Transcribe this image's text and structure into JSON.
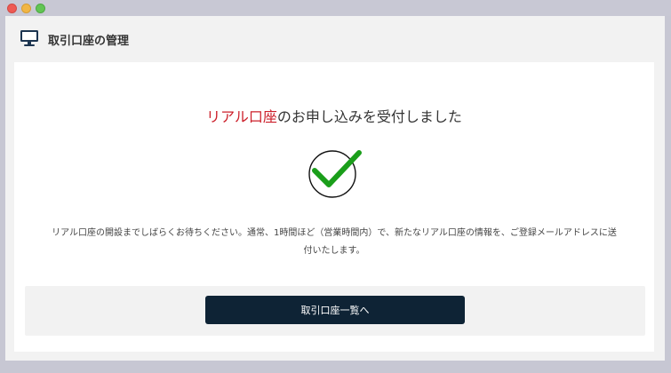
{
  "header": {
    "title": "取引口座の管理",
    "icon": "monitor-icon"
  },
  "confirmation": {
    "heading_accent": "リアル口座",
    "heading_rest": "のお申し込みを受付しました",
    "icon": "check-circle-icon",
    "message": "リアル口座の開設までしばらくお待ちください。通常、1時間ほど（営業時間内）で、新たなリアル口座の情報を、ご登録メールアドレスに送付いたします。"
  },
  "actions": {
    "primary_label": "取引口座一覧へ"
  },
  "colors": {
    "accent_red": "#cc1f2a",
    "check_green": "#1a9e1a",
    "button_navy": "#0e2335",
    "icon_navy": "#1c3550"
  }
}
